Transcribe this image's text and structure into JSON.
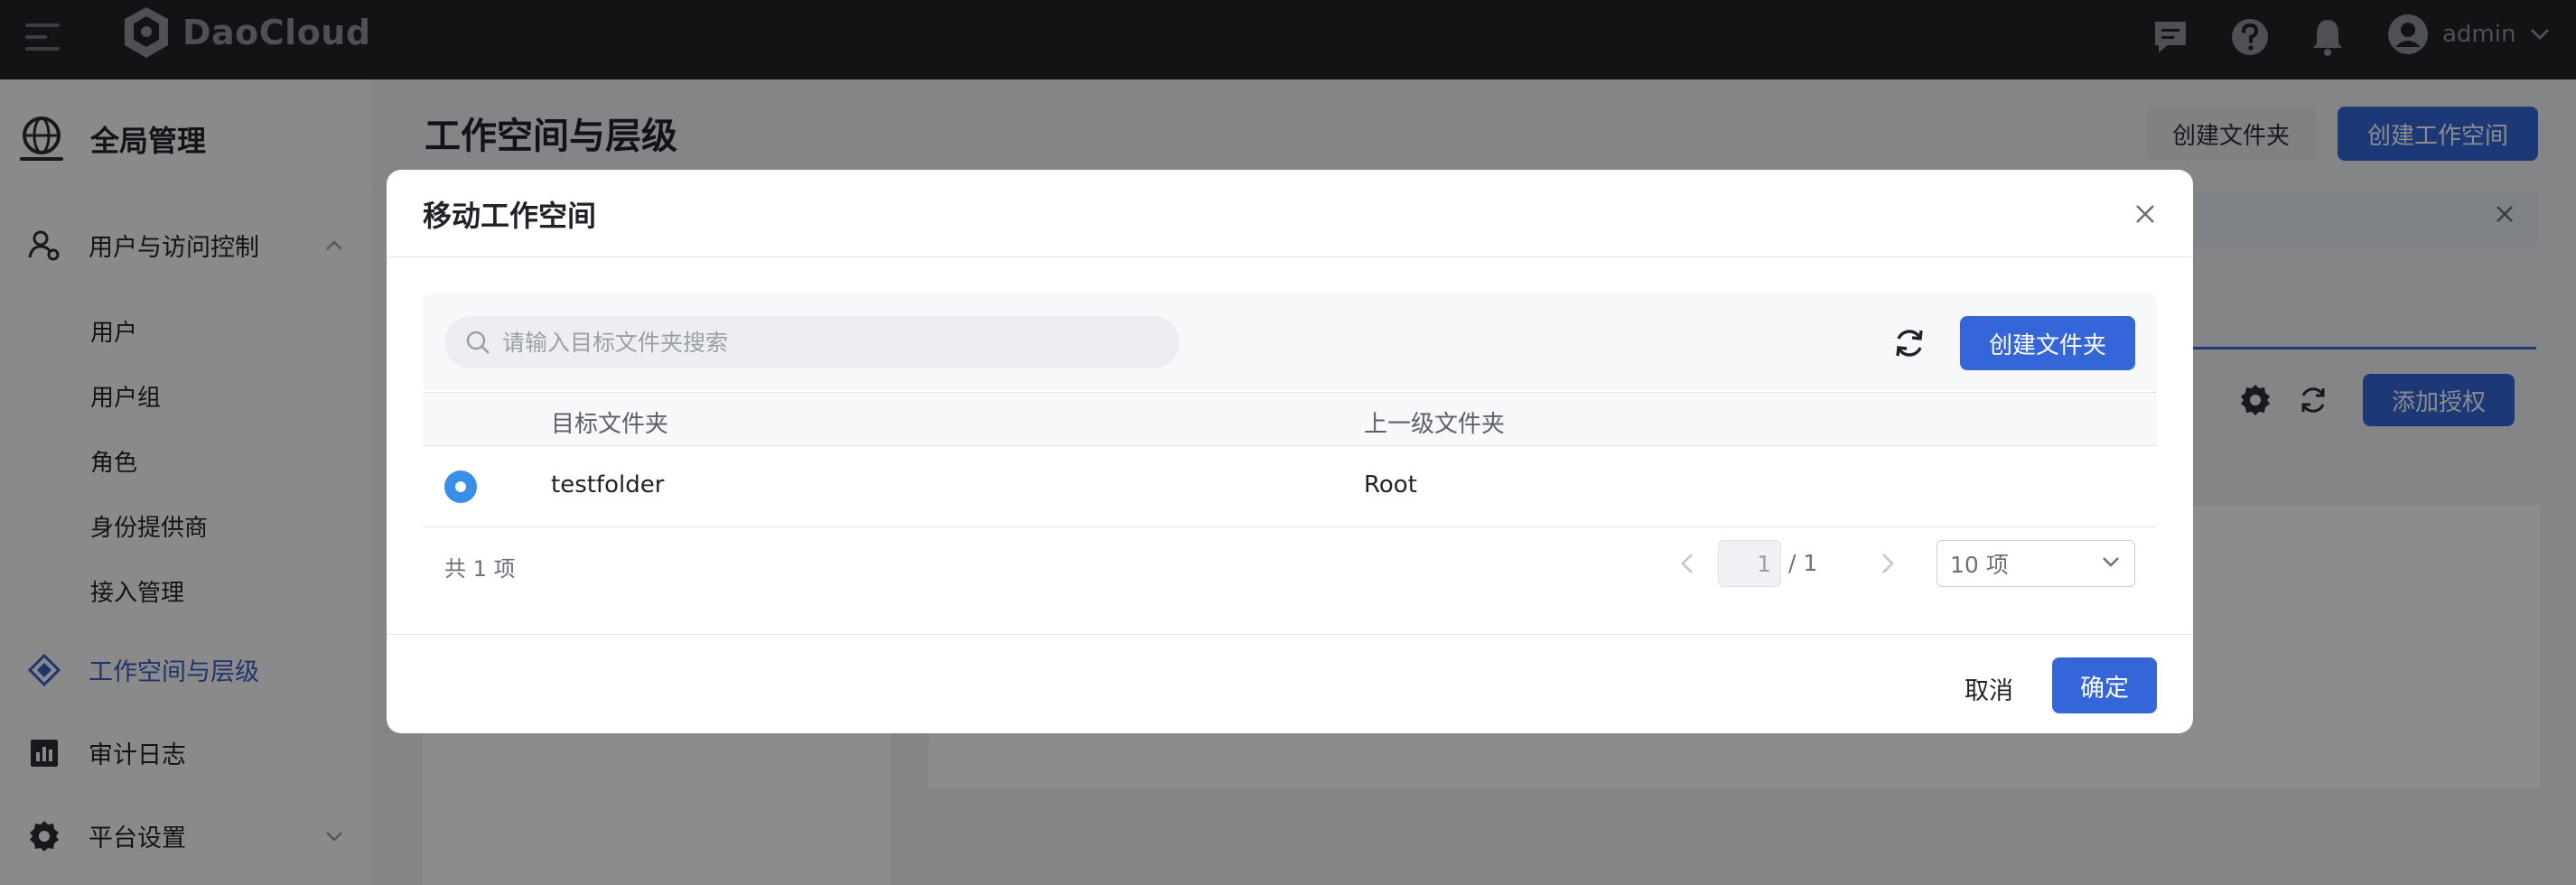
{
  "topbar": {
    "brand": "DaoCloud",
    "user_name": "admin",
    "icons": [
      "menu-icon",
      "daocloud-logo-icon",
      "message-icon",
      "help-icon",
      "bell-icon",
      "user-avatar-icon",
      "chevron-down-icon"
    ]
  },
  "sidebar": {
    "module_title": "全局管理",
    "groups": [
      {
        "label": "用户与访问控制",
        "icon": "user-access-icon",
        "expanded": true
      },
      {
        "label": "工作空间与层级",
        "icon": "workspace-icon",
        "active": true
      },
      {
        "label": "审计日志",
        "icon": "audit-log-icon"
      },
      {
        "label": "平台设置",
        "icon": "settings-icon",
        "expanded": false
      }
    ],
    "sub_items": [
      "用户",
      "用户组",
      "角色",
      "身份提供商",
      "接入管理"
    ]
  },
  "page": {
    "title": "工作空间与层级",
    "create_folder_label": "创建文件夹",
    "create_workspace_label": "创建工作空间",
    "add_auth_label": "添加授权"
  },
  "modal": {
    "title": "移动工作空间",
    "search_placeholder": "请输入目标文件夹搜索",
    "create_folder_label": "创建文件夹",
    "columns": [
      "目标文件夹",
      "上一级文件夹"
    ],
    "rows": [
      {
        "target": "testfolder",
        "parent": "Root",
        "selected": true
      }
    ],
    "total_text": "共 1 项",
    "current_page": "1",
    "total_pages": "/ 1",
    "page_size": "10 项",
    "cancel_label": "取消",
    "ok_label": "确定"
  },
  "colors": {
    "primary": "#3466d9",
    "radio": "#3a8ee8",
    "topbar_bg": "#1f2327"
  }
}
